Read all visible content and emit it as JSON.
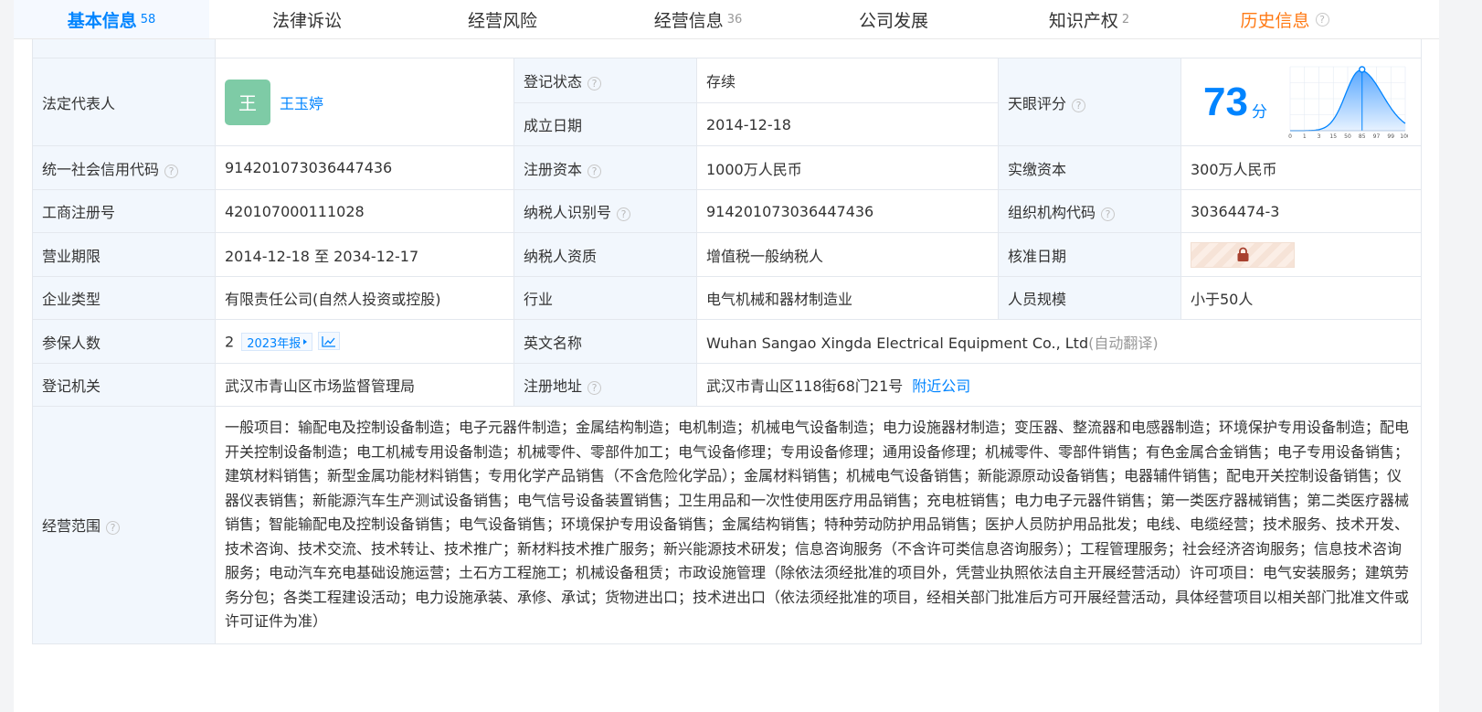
{
  "tabs": [
    {
      "label": "基本信息",
      "count": "58"
    },
    {
      "label": "法律诉讼",
      "count": ""
    },
    {
      "label": "经营风险",
      "count": ""
    },
    {
      "label": "经营信息",
      "count": "36"
    },
    {
      "label": "公司发展",
      "count": ""
    },
    {
      "label": "知识产权",
      "count": "2"
    },
    {
      "label": "历史信息",
      "count": ""
    }
  ],
  "help_glyph": "?",
  "legal_rep": {
    "label": "法定代表人",
    "avatar_char": "王",
    "name": "王玉婷"
  },
  "reg_status": {
    "label": "登记状态",
    "value": "存续"
  },
  "founded": {
    "label": "成立日期",
    "value": "2014-12-18"
  },
  "tianyan_score": {
    "label": "天眼评分",
    "value": "73",
    "unit": "分",
    "chart": {
      "ticks": [
        "0",
        "1",
        "3",
        "15",
        "50",
        "85",
        "97",
        "99",
        "100"
      ],
      "marker_tick": "85",
      "colors": {
        "curve": "#0084ff",
        "fill_top": "#5aa8ff",
        "fill_bottom": "#e7f2ff",
        "grid": "#e3eaf3"
      }
    }
  },
  "credit_code": {
    "label": "统一社会信用代码",
    "value": "914201073036447436"
  },
  "reg_capital": {
    "label": "注册资本",
    "value": "1000万人民币"
  },
  "paid_capital": {
    "label": "实缴资本",
    "value": "300万人民币"
  },
  "biz_reg_no": {
    "label": "工商注册号",
    "value": "420107000111028"
  },
  "taxpayer_id": {
    "label": "纳税人识别号",
    "value": "914201073036447436"
  },
  "org_code": {
    "label": "组织机构代码",
    "value": "30364474-3"
  },
  "biz_term": {
    "label": "营业期限",
    "value": "2014-12-18 至 2034-12-17"
  },
  "taxpayer_qual": {
    "label": "纳税人资质",
    "value": "增值税一般纳税人"
  },
  "approval_date": {
    "label": "核准日期",
    "value": "",
    "icon": "lock-icon"
  },
  "company_type": {
    "label": "企业类型",
    "value": "有限责任公司(自然人投资或控股)"
  },
  "industry": {
    "label": "行业",
    "value": "电气机械和器材制造业"
  },
  "staff_size": {
    "label": "人员规模",
    "value": "小于50人"
  },
  "insured": {
    "label": "参保人数",
    "value": "2",
    "report": "2023年报",
    "icon": "trend-chart-icon"
  },
  "english_name": {
    "label": "英文名称",
    "value": "Wuhan Sangao Xingda Electrical Equipment Co., Ltd",
    "note": "(自动翻译)"
  },
  "reg_authority": {
    "label": "登记机关",
    "value": "武汉市青山区市场监督管理局"
  },
  "reg_address": {
    "label": "注册地址",
    "value": "武汉市青山区118街68门21号",
    "nearby": "附近公司"
  },
  "biz_scope": {
    "label": "经营范围",
    "value": "一般项目：输配电及控制设备制造；电子元器件制造；金属结构制造；电机制造；机械电气设备制造；电力设施器材制造；变压器、整流器和电感器制造；环境保护专用设备制造；配电开关控制设备制造；电工机械专用设备制造；机械零件、零部件加工；电气设备修理；专用设备修理；通用设备修理；机械零件、零部件销售；有色金属合金销售；电子专用设备销售；建筑材料销售；新型金属功能材料销售；专用化学产品销售（不含危险化学品）；金属材料销售；机械电气设备销售；新能源原动设备销售；电器辅件销售；配电开关控制设备销售；仪器仪表销售；新能源汽车生产测试设备销售；电气信号设备装置销售；卫生用品和一次性使用医疗用品销售；充电桩销售；电力电子元器件销售；第一类医疗器械销售；第二类医疗器械销售；智能输配电及控制设备销售；电气设备销售；环境保护专用设备销售；金属结构销售；特种劳动防护用品销售；医护人员防护用品批发；电线、电缆经营；技术服务、技术开发、技术咨询、技术交流、技术转让、技术推广；新材料技术推广服务；新兴能源技术研发；信息咨询服务（不含许可类信息咨询服务）；工程管理服务；社会经济咨询服务；信息技术咨询服务；电动汽车充电基础设施运营；土石方工程施工；机械设备租赁；市政设施管理（除依法须经批准的项目外，凭营业执照依法自主开展经营活动）许可项目：电气安装服务；建筑劳务分包；各类工程建设活动；电力设施承装、承修、承试；货物进出口；技术进出口（依法须经批准的项目，经相关部门批准后方可开展经营活动，具体经营项目以相关部门批准文件或许可证件为准）"
  }
}
